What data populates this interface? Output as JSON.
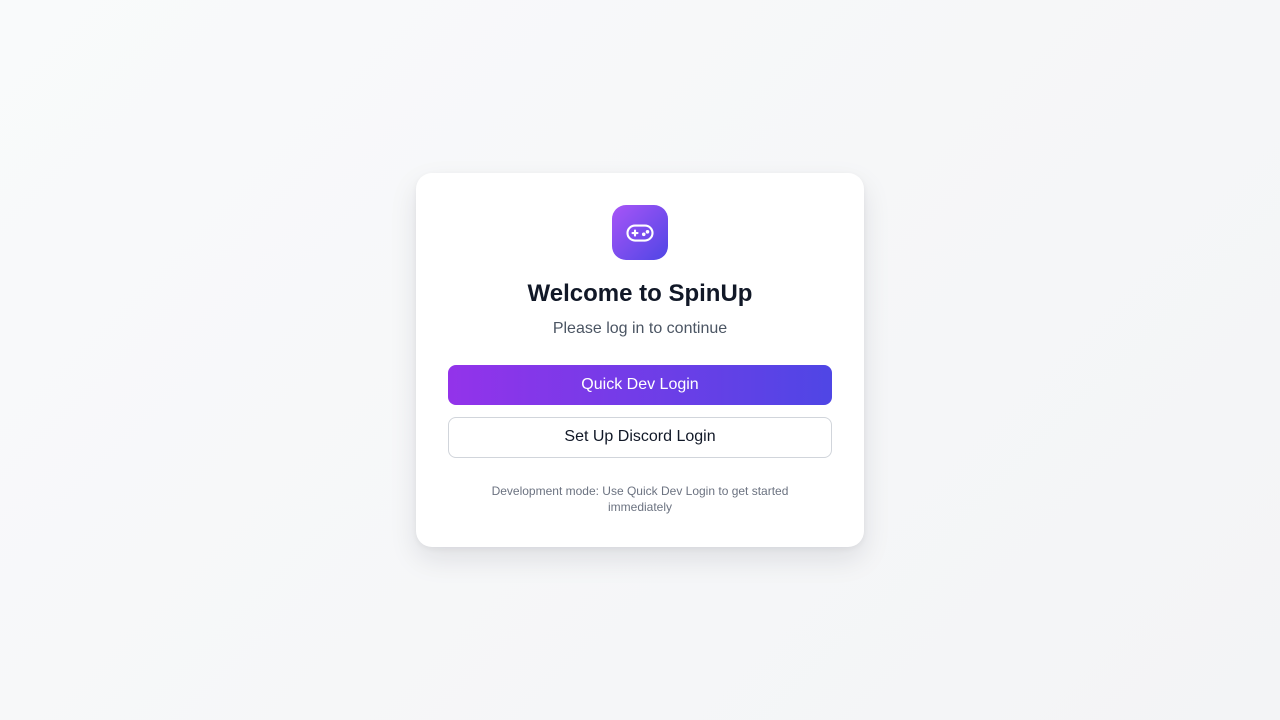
{
  "app": {
    "logo_icon": "gamepad-icon",
    "accent_gradient": [
      "#9333ea",
      "#4f46e5"
    ]
  },
  "login": {
    "title": "Welcome to SpinUp",
    "subtitle": "Please log in to continue",
    "quick_dev_label": "Quick Dev Login",
    "discord_label": "Set Up Discord Login",
    "note": "Development mode: Use Quick Dev Login to get started immediately"
  }
}
